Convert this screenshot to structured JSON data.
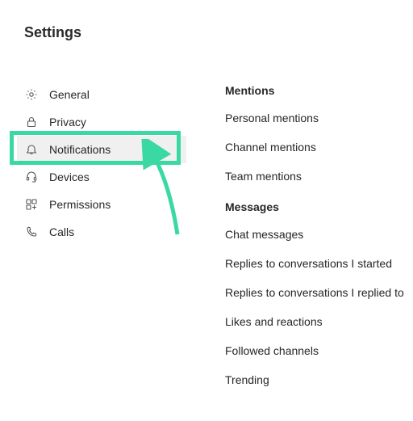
{
  "title": "Settings",
  "sidebar": {
    "items": [
      {
        "label": "General"
      },
      {
        "label": "Privacy"
      },
      {
        "label": "Notifications"
      },
      {
        "label": "Devices"
      },
      {
        "label": "Permissions"
      },
      {
        "label": "Calls"
      }
    ]
  },
  "content": {
    "section1": {
      "title": "Mentions",
      "rows": [
        "Personal mentions",
        "Channel mentions",
        "Team mentions"
      ]
    },
    "section2": {
      "title": "Messages",
      "rows": [
        "Chat messages",
        "Replies to conversations I started",
        "Replies to conversations I replied to",
        "Likes and reactions",
        "Followed channels",
        "Trending"
      ]
    }
  },
  "accent": "#3ad9a4"
}
